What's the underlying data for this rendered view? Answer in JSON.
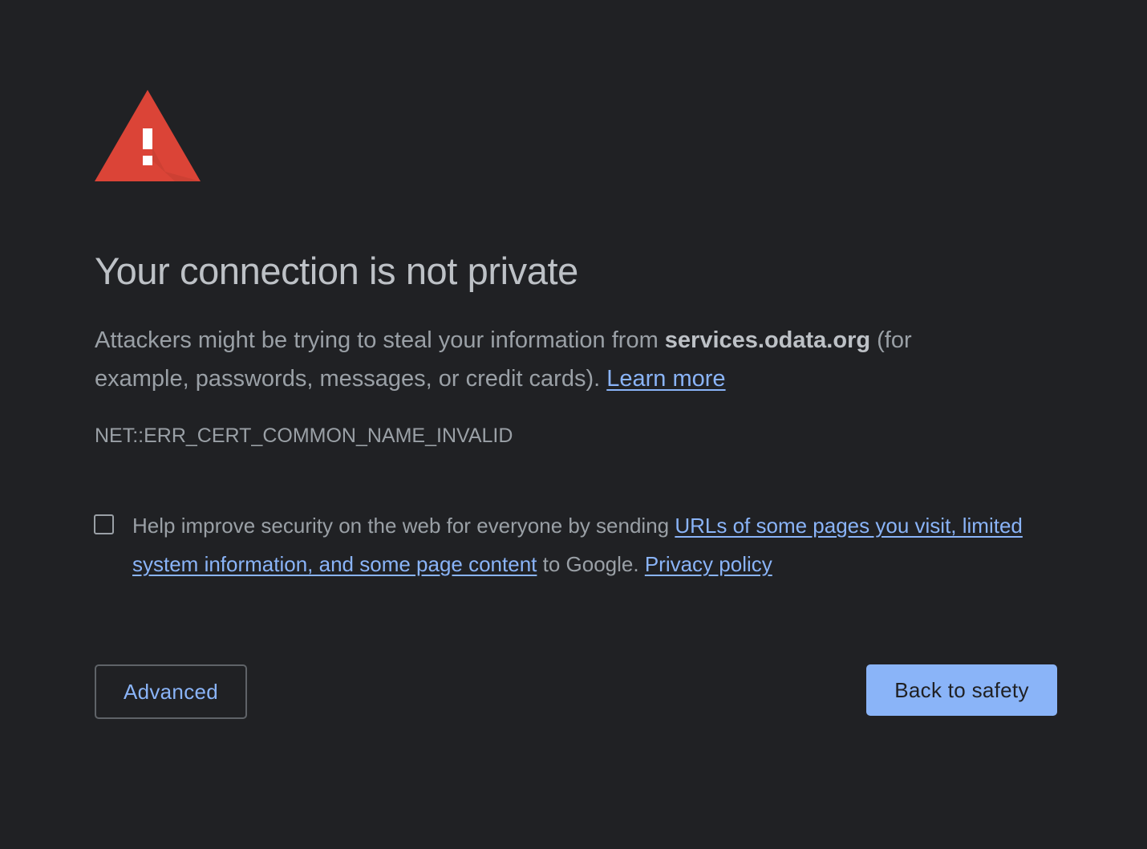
{
  "page": {
    "title": "Your connection is not private",
    "message": {
      "before_host": "Attackers might be trying to steal your information from ",
      "host": "services.odata.org",
      "after_host": " (for example, passwords, messages, or credit cards). ",
      "learn_more": "Learn more"
    },
    "error_code": "NET::ERR_CERT_COMMON_NAME_INVALID"
  },
  "optin": {
    "checked": false,
    "text_before": "Help improve security on the web for everyone by sending ",
    "link_text": "URLs of some pages you visit, limited system information, and some page content",
    "text_middle": " to Google. ",
    "privacy_link": "Privacy policy"
  },
  "buttons": {
    "advanced": "Advanced",
    "back_to_safety": "Back to safety"
  },
  "icons": {
    "warning": "warning-triangle-icon"
  },
  "colors": {
    "background": "#202124",
    "warning_red": "#db4437",
    "link": "#8ab4f8",
    "primary_button": "#8ab4f8"
  }
}
